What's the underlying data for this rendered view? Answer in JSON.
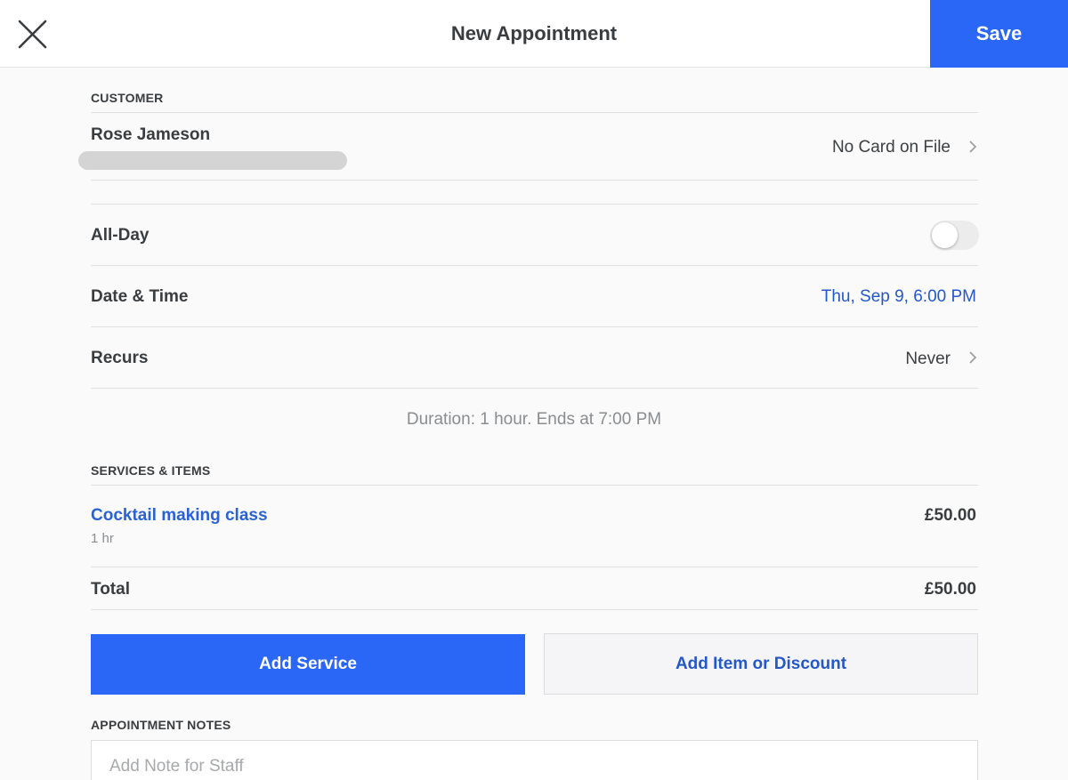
{
  "header": {
    "title": "New Appointment",
    "save_label": "Save"
  },
  "customer": {
    "section_label": "CUSTOMER",
    "name": "Rose Jameson",
    "card_status": "No Card on File"
  },
  "schedule": {
    "all_day_label": "All-Day",
    "all_day_on": false,
    "date_time_label": "Date & Time",
    "date_time_value": "Thu, Sep 9, 6:00 PM",
    "recurs_label": "Recurs",
    "recurs_value": "Never",
    "duration_text": "Duration: 1 hour. Ends at 7:00 PM"
  },
  "services": {
    "section_label": "SERVICES & ITEMS",
    "items": [
      {
        "name": "Cocktail making class",
        "duration": "1 hr",
        "price": "£50.00"
      }
    ],
    "total_label": "Total",
    "total_value": "£50.00",
    "add_service_label": "Add Service",
    "add_item_label": "Add Item or Discount"
  },
  "notes": {
    "section_label": "APPOINTMENT NOTES",
    "placeholder": "Add Note for Staff"
  },
  "colors": {
    "accent": "#2b67f6",
    "link": "#2458c8"
  }
}
